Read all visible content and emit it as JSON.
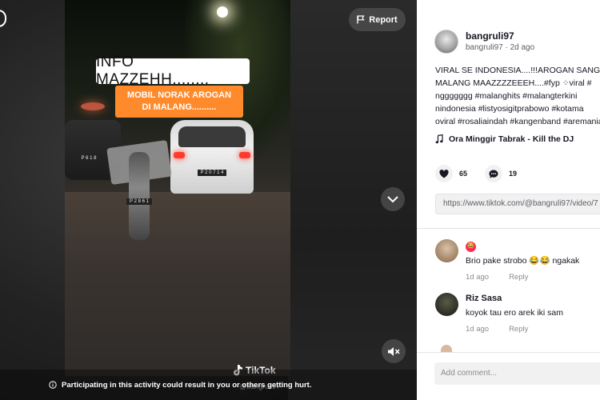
{
  "video": {
    "report_label": "Report",
    "caption_main": "INFO MAZZEHH........",
    "caption_sub_line1": "MOBIL NORAK AROGAN",
    "caption_sub_line2": "DI MALANG..........",
    "plate_car": "P 2 0 7 1 4",
    "plate_moto": "P 2 8 6 1",
    "plate_dark_car": "P 6 1 8",
    "tiktok_logo_text": "TikTok",
    "watermark": "@bangruli97",
    "warning_text": "Participating in this activity could result in you or others getting hurt.",
    "icons": {
      "report": "flag-icon",
      "scroll": "chevron-down-icon",
      "mute": "speaker-muted-icon",
      "warning": "info-circle-icon",
      "logo": "tiktok-note-icon"
    }
  },
  "panel": {
    "author": {
      "display_name": "bangruli97",
      "meta": "bangruli97 · 2d ago"
    },
    "description_lines": [
      "VIRAL SE INDONESIA....!!!AROGAN SANGAT",
      "MALANG MAAZZZZEEEH....#fyp ⁘viral #",
      "nggggggg #malanghits #malangterkini",
      "nindonesia #listyosigitprabowo #kotama",
      "oviral #rosaliaindah #kangenband #aremania"
    ],
    "music": "Ora Minggir Tabrak - Kill the DJ",
    "likes": "65",
    "comments_count": "19",
    "share_link": "https://www.tiktok.com/@bangruli97/video/7",
    "comments": [
      {
        "name": "",
        "text": "Brio pake strobo 😂😂 ngakak",
        "time": "1d ago",
        "reply": "Reply"
      },
      {
        "name": "Riz Sasa",
        "text": "koyok tau ero arek iki sam",
        "time": "1d ago",
        "reply": "Reply"
      }
    ],
    "add_comment_placeholder": "Add comment..."
  },
  "colors": {
    "accent": "#fe2c55",
    "caption_orange": "#ff8a2b",
    "text_primary": "#161823",
    "text_secondary": "#8a8b91"
  }
}
